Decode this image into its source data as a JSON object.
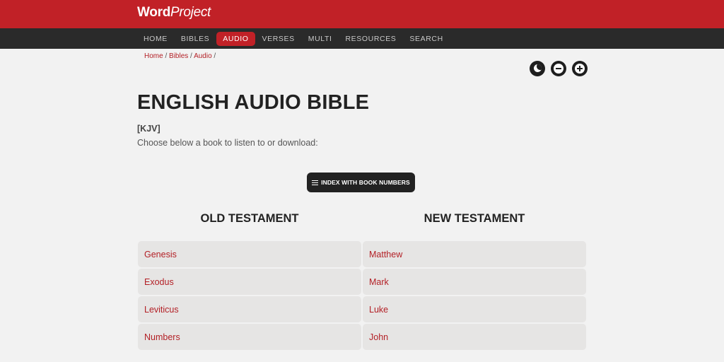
{
  "header": {
    "logo_bold": "Word",
    "logo_italic": "Project",
    "brand_color": "#c12127"
  },
  "nav": {
    "items": [
      {
        "label": "HOME",
        "active": false
      },
      {
        "label": "BIBLES",
        "active": false
      },
      {
        "label": "AUDIO",
        "active": true
      },
      {
        "label": "VERSES",
        "active": false
      },
      {
        "label": "MULTI",
        "active": false
      },
      {
        "label": "RESOURCES",
        "active": false
      },
      {
        "label": "SEARCH",
        "active": false
      }
    ]
  },
  "breadcrumb": {
    "home": "Home",
    "bibles": "Bibles",
    "audio": "Audio",
    "separator": " / "
  },
  "tools": {
    "icons": [
      "moon-icon",
      "minus-circle-icon",
      "plus-circle-icon"
    ]
  },
  "main": {
    "title": "ENGLISH AUDIO BIBLE",
    "version": "[KJV]",
    "intro": "Choose below a book to listen to or download:",
    "index_button": "INDEX WITH BOOK NUMBERS"
  },
  "old_testament": {
    "heading": "OLD TESTAMENT",
    "books": [
      "Genesis",
      "Exodus",
      "Leviticus",
      "Numbers"
    ]
  },
  "new_testament": {
    "heading": "NEW TESTAMENT",
    "books": [
      "Matthew",
      "Mark",
      "Luke",
      "John"
    ]
  }
}
